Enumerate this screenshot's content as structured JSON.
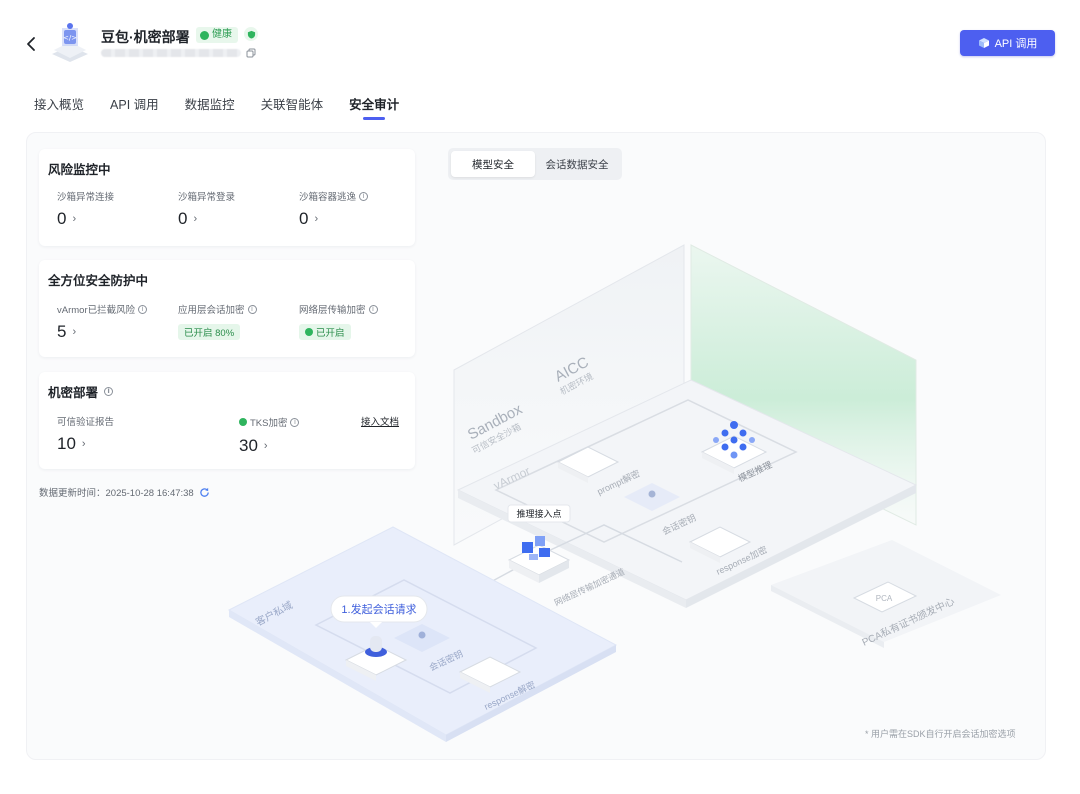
{
  "header": {
    "app_title": "豆包·机密部署",
    "health_label": "健康",
    "api_button": "API 调用"
  },
  "tabs": [
    {
      "label": "接入概览"
    },
    {
      "label": "API 调用"
    },
    {
      "label": "数据监控"
    },
    {
      "label": "关联智能体"
    },
    {
      "label": "安全审计",
      "active": true
    }
  ],
  "risk": {
    "title": "风险监控中",
    "metrics": [
      {
        "label": "沙箱异常连接",
        "value": "0"
      },
      {
        "label": "沙箱异常登录",
        "value": "0"
      },
      {
        "label": "沙箱容器逃逸",
        "value": "0"
      }
    ]
  },
  "protection": {
    "title": "全方位安全防护中",
    "varmor_label": "vArmor已拦截风险",
    "varmor_value": "5",
    "app_encrypt_label": "应用层会话加密",
    "app_encrypt_status": "已开启 80%",
    "net_encrypt_label": "网络层传输加密",
    "net_encrypt_status": "已开启"
  },
  "confidential": {
    "title": "机密部署",
    "report_label": "可信验证报告",
    "report_value": "10",
    "tks_label": "TKS加密",
    "tks_value": "30",
    "doc_link": "接入文档"
  },
  "update_time": "数据更新时间：2025-10-28 16:47:38",
  "segment": {
    "items": [
      "模型安全",
      "会话数据安全"
    ],
    "active": 0
  },
  "diagram": {
    "sandbox": "Sandbox",
    "sandbox_sub": "可信安全沙箱",
    "aicc": "AICC",
    "aicc_sub": "机密环境",
    "varmor": "vArmor",
    "prompt_decrypt": "prompt解密",
    "session_key": "会话密钥",
    "model_infer": "模型推理",
    "response_encrypt": "response加密",
    "infer_entry": "推理接入点",
    "tunnel": "网络层传输加密通道",
    "client_domain": "客户私域",
    "start_session": "1.发起会话请求",
    "client_session_key": "会话密钥",
    "client_response": "response解密",
    "pca": "PCA",
    "pca_center": "PCA私有证书颁发中心",
    "footnote": "* 用户需在SDK自行开启会话加密选项"
  },
  "colors": {
    "accent": "#4d5ff0",
    "success": "#2fb45e",
    "aicc_wall": "#c9ecd6"
  }
}
